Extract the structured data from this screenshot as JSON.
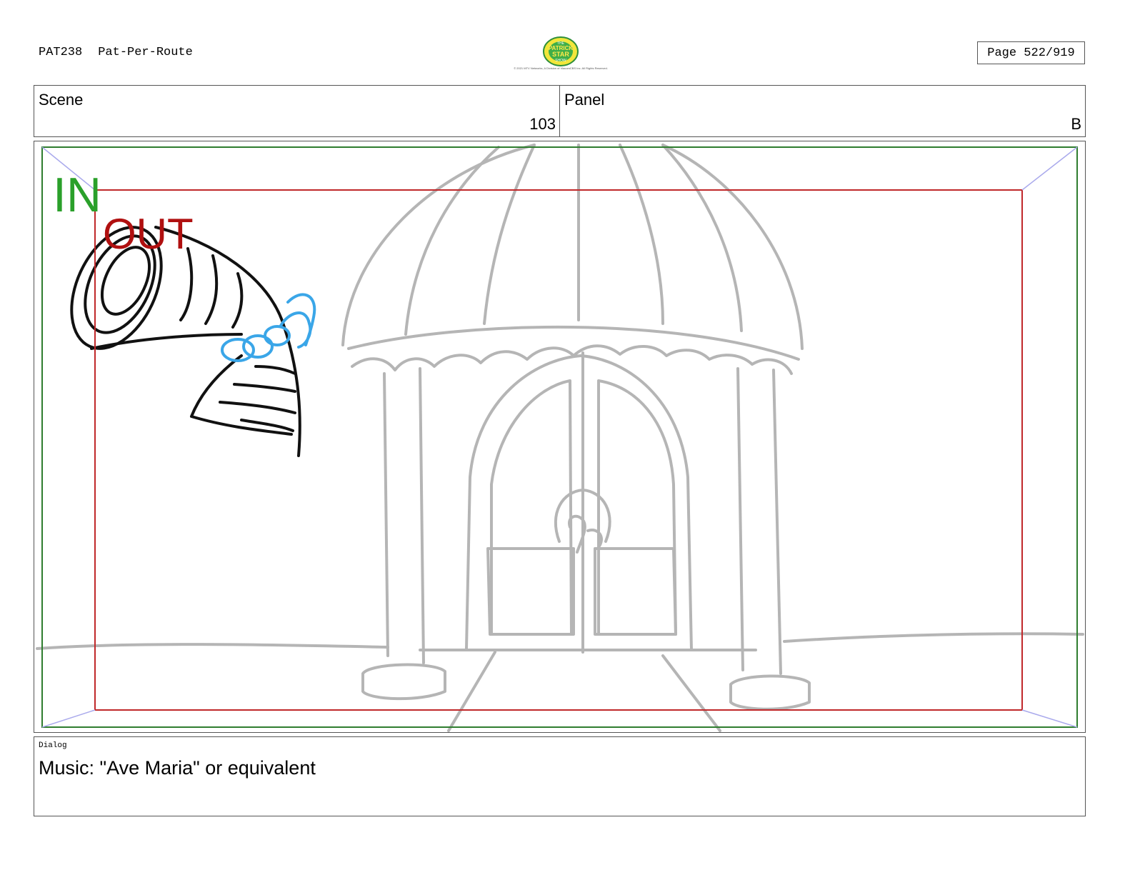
{
  "header": {
    "episode_code": "PAT238",
    "episode_title": "Pat-Per-Route",
    "page": "Page 522/919"
  },
  "logo": {
    "text_line1": "THE",
    "text_line2": "PATRICK",
    "text_line3": "STAR",
    "text_line4": "SHOW",
    "copyright": "© 2021 MTV Networks, A Division of ViacomCBS Inc. All Rights Reserved."
  },
  "scene": {
    "label": "Scene",
    "value": "103"
  },
  "panel": {
    "label": "Panel",
    "value": "B"
  },
  "frame": {
    "in_label": "IN",
    "out_label": "OUT",
    "in_color": "#2aa02a",
    "out_color": "#b01010",
    "sketch_color": "#b5b5b5",
    "character_color": "#3aa6e8"
  },
  "dialog": {
    "label": "Dialog",
    "text": "Music: \"Ave Maria\" or equivalent"
  }
}
